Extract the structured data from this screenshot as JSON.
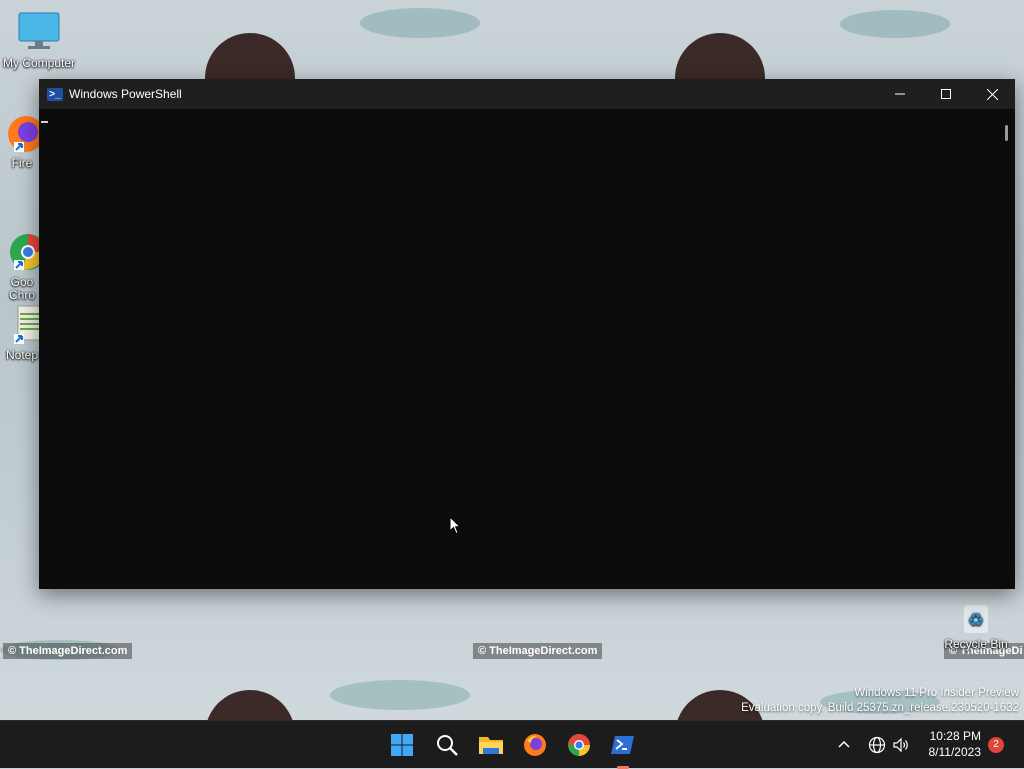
{
  "desktop": {
    "icons": [
      {
        "label": "My Computer"
      },
      {
        "label": "Fire"
      },
      {
        "label": "Goo\nChro"
      },
      {
        "label": "Notep"
      },
      {
        "label": "Recycle Bin"
      }
    ],
    "watermarks": [
      "© TheImageDirect.com",
      "© TheImageDirect.com",
      "© TheImageDi"
    ]
  },
  "window": {
    "title": "Windows PowerShell",
    "minimize_glyph": "—",
    "maximize_glyph": "☐",
    "close_glyph": "✕"
  },
  "os_watermark": {
    "line1": "Windows 11 Pro Insider Preview",
    "line2": "Evaluation copy. Build 25375.zn_release.230520-1632"
  },
  "taskbar": {
    "apps": [
      {
        "name": "Start",
        "icon": "windows-start-icon"
      },
      {
        "name": "Search",
        "icon": "search-icon"
      },
      {
        "name": "File Explorer",
        "icon": "folder-icon"
      },
      {
        "name": "Firefox",
        "icon": "firefox-icon"
      },
      {
        "name": "Google Chrome",
        "icon": "chrome-icon"
      },
      {
        "name": "Windows PowerShell",
        "icon": "powershell-icon",
        "active": true
      }
    ],
    "tray": {
      "overflow_glyph": "^",
      "time": "10:28 PM",
      "date": "8/11/2023",
      "notification_count": "2"
    }
  },
  "colors": {
    "console_bg": "#0c0c0c",
    "titlebar_bg": "#1f1f1f",
    "taskbar_bg": "#1c1c1c",
    "accent_active": "#f07a66",
    "badge": "#e0453a"
  }
}
